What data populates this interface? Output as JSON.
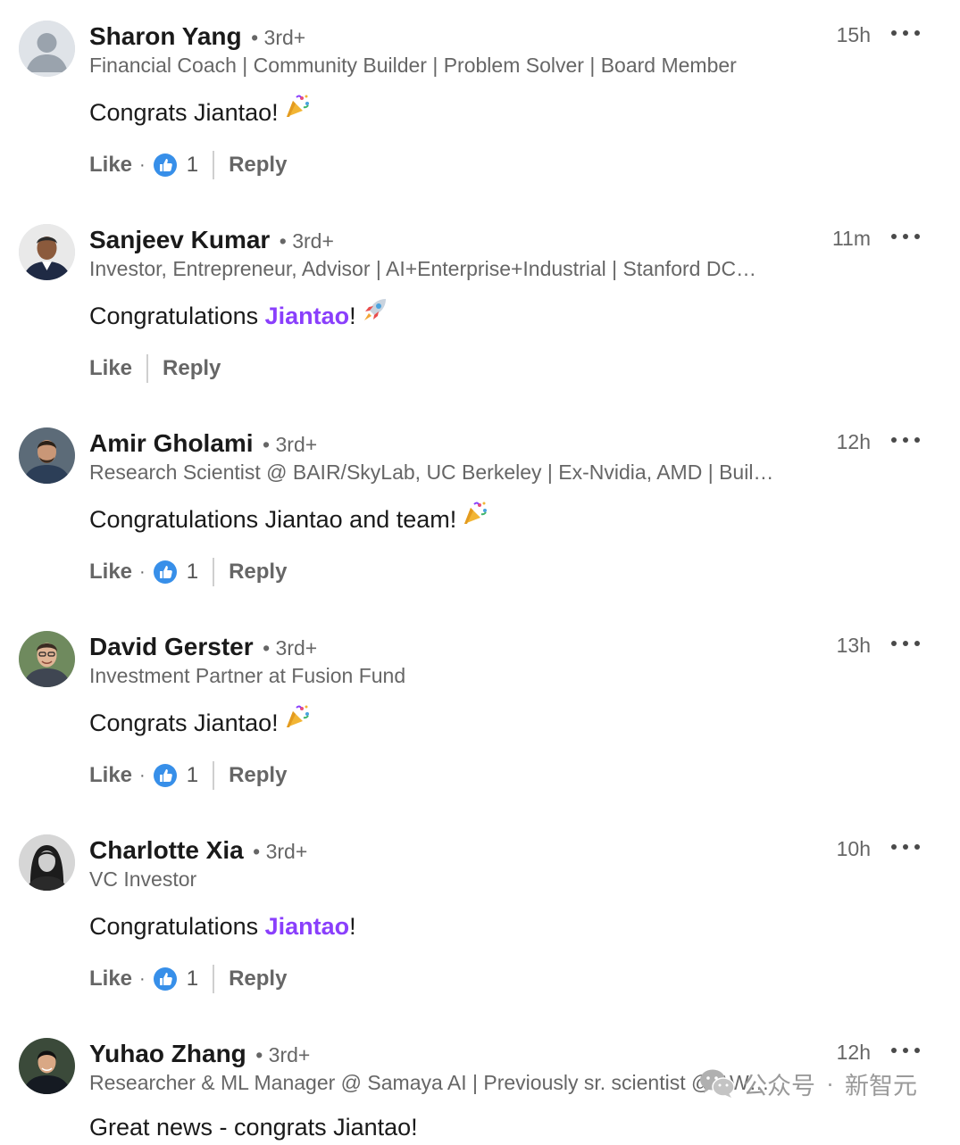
{
  "comments": [
    {
      "name": "Sharon Yang",
      "degree": "• 3rd+",
      "headline": "Financial Coach | Community Builder | Problem Solver | Board Member",
      "time": "15h",
      "text_before": "Congrats Jiantao!",
      "mention": "",
      "text_after": "",
      "emoji": "party-popper",
      "like_label": "Like",
      "reaction_sep": "·",
      "reaction_count": "1",
      "reply_label": "Reply",
      "avatar": "default-avatar"
    },
    {
      "name": "Sanjeev Kumar",
      "degree": "• 3rd+",
      "headline": "Investor, Entrepreneur, Advisor | AI+Enterprise+Industrial | Stanford DC…",
      "time": "11m",
      "text_before": "Congratulations ",
      "mention": "Jiantao",
      "text_after": "!",
      "emoji": "rocket",
      "like_label": "Like",
      "reaction_sep": "",
      "reaction_count": "",
      "reply_label": "Reply",
      "avatar": "photo"
    },
    {
      "name": "Amir Gholami",
      "degree": "• 3rd+",
      "headline": "Research Scientist @ BAIR/SkyLab, UC Berkeley | Ex-Nvidia, AMD | Buil…",
      "time": "12h",
      "text_before": "Congratulations Jiantao and team!",
      "mention": "",
      "text_after": "",
      "emoji": "party-popper",
      "like_label": "Like",
      "reaction_sep": "·",
      "reaction_count": "1",
      "reply_label": "Reply",
      "avatar": "photo"
    },
    {
      "name": "David Gerster",
      "degree": "• 3rd+",
      "headline": "Investment Partner at Fusion Fund",
      "time": "13h",
      "text_before": "Congrats Jiantao!",
      "mention": "",
      "text_after": "",
      "emoji": "party-popper",
      "like_label": "Like",
      "reaction_sep": "·",
      "reaction_count": "1",
      "reply_label": "Reply",
      "avatar": "photo"
    },
    {
      "name": "Charlotte Xia",
      "degree": "• 3rd+",
      "headline": "VC Investor",
      "time": "10h",
      "text_before": "Congratulations ",
      "mention": "Jiantao",
      "text_after": "!",
      "emoji": "",
      "like_label": "Like",
      "reaction_sep": "·",
      "reaction_count": "1",
      "reply_label": "Reply",
      "avatar": "photo"
    },
    {
      "name": "Yuhao Zhang",
      "degree": "• 3rd+",
      "headline": "Researcher & ML Manager @ Samaya AI | Previously sr. scientist @ AW…",
      "time": "12h",
      "text_before": "Great news - congrats Jiantao!",
      "mention": "",
      "text_after": "",
      "emoji": "",
      "like_label": "",
      "reaction_sep": "",
      "reaction_count": "",
      "reply_label": "",
      "avatar": "photo"
    }
  ],
  "watermark": {
    "source": "公众号",
    "separator": "·",
    "account": "新智元",
    "icon": "wechat-icon"
  },
  "colors": {
    "mention": "#8a3ffc",
    "like_reaction": "#378fe9",
    "secondary_text": "#666666"
  }
}
